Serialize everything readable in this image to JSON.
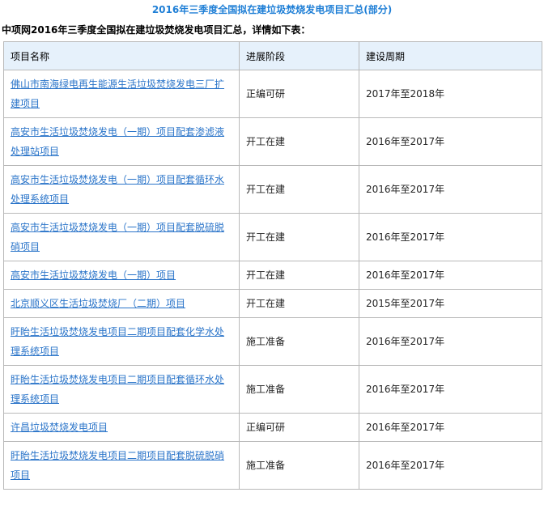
{
  "title": "2016年三季度全国拟在建垃圾焚烧发电项目汇总(部分)",
  "intro": "中项网2016年三季度全国拟在建垃圾焚烧发电项目汇总，详情如下表：",
  "table": {
    "headers": [
      "项目名称",
      "进展阶段",
      "建设周期"
    ],
    "rows": [
      {
        "name": "佛山市南海绿电再生能源生活垃圾焚烧发电三厂扩建项目",
        "stage": "正编可研",
        "period": "2017年至2018年"
      },
      {
        "name": "高安市生活垃圾焚烧发电（一期）项目配套渗滤液处理站项目",
        "stage": "开工在建",
        "period": "2016年至2017年"
      },
      {
        "name": "高安市生活垃圾焚烧发电（一期）项目配套循环水处理系统项目",
        "stage": "开工在建",
        "period": "2016年至2017年"
      },
      {
        "name": "高安市生活垃圾焚烧发电（一期）项目配套脱硫脱硝项目",
        "stage": "开工在建",
        "period": "2016年至2017年"
      },
      {
        "name": "高安市生活垃圾焚烧发电（一期）项目",
        "stage": "开工在建",
        "period": "2016年至2017年"
      },
      {
        "name": "北京顺义区生活垃圾焚烧厂（二期）项目",
        "stage": "开工在建",
        "period": "2015年至2017年"
      },
      {
        "name": "盱眙生活垃圾焚烧发电项目二期项目配套化学水处理系统项目",
        "stage": "施工准备",
        "period": "2016年至2017年"
      },
      {
        "name": "盱眙生活垃圾焚烧发电项目二期项目配套循环水处理系统项目",
        "stage": "施工准备",
        "period": "2016年至2017年"
      },
      {
        "name": "许昌垃圾焚烧发电项目",
        "stage": "正编可研",
        "period": "2016年至2017年"
      },
      {
        "name": "盱眙生活垃圾焚烧发电项目二期项目配套脱硫脱硝项目",
        "stage": "施工准备",
        "period": "2016年至2017年"
      }
    ]
  },
  "colors": {
    "title": "#1f7fd6",
    "link": "#2a74c9",
    "header_bg": "#e6f1fb",
    "border": "#b9b9b9"
  }
}
